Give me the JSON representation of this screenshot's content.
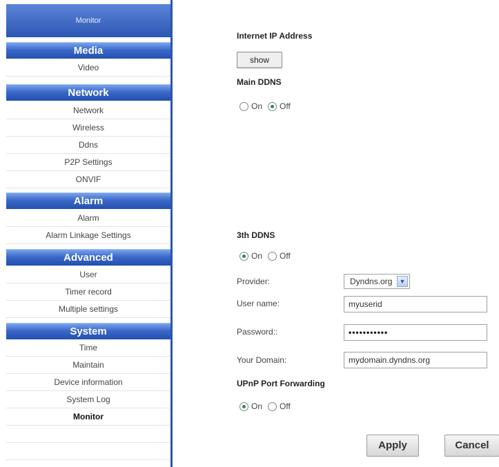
{
  "sidebar": {
    "top_item": "Monitor",
    "sections": {
      "media": {
        "title": "Media",
        "items": [
          "Video"
        ]
      },
      "network": {
        "title": "Network",
        "items": [
          "Network",
          "Wireless",
          "Ddns",
          "P2P Settings",
          "ONVIF"
        ]
      },
      "alarm": {
        "title": "Alarm",
        "items": [
          "Alarm",
          "Alarm Linkage Settings"
        ]
      },
      "advanced": {
        "title": "Advanced",
        "items": [
          "User",
          "Timer record",
          "Multiple settings"
        ]
      },
      "system": {
        "title": "System",
        "items": [
          "Time",
          "Maintain",
          "Device information",
          "System Log",
          "Monitor"
        ]
      }
    }
  },
  "main": {
    "internet_ip_label": "Internet IP Address",
    "show_button": "show",
    "main_ddns": {
      "label": "Main DDNS",
      "on": "On",
      "off": "Off",
      "selected": "Off"
    },
    "third_ddns": {
      "label": "3th DDNS",
      "on": "On",
      "off": "Off",
      "selected": "On"
    },
    "provider": {
      "label": "Provider:",
      "value": "Dyndns.org"
    },
    "username": {
      "label": "User name:",
      "value": "myuserid"
    },
    "password": {
      "label": "Password::",
      "value": "•••••••••••"
    },
    "domain": {
      "label": "Your Domain:",
      "value": "mydomain.dyndns.org"
    },
    "upnp": {
      "label": "UPnP Port Forwarding",
      "on": "On",
      "off": "Off",
      "selected": "On"
    },
    "apply_button": "Apply",
    "cancel_button": "Cancel"
  },
  "colors": {
    "nav_blue": "#2c56b2",
    "radio_checked": "#2e8b57"
  }
}
